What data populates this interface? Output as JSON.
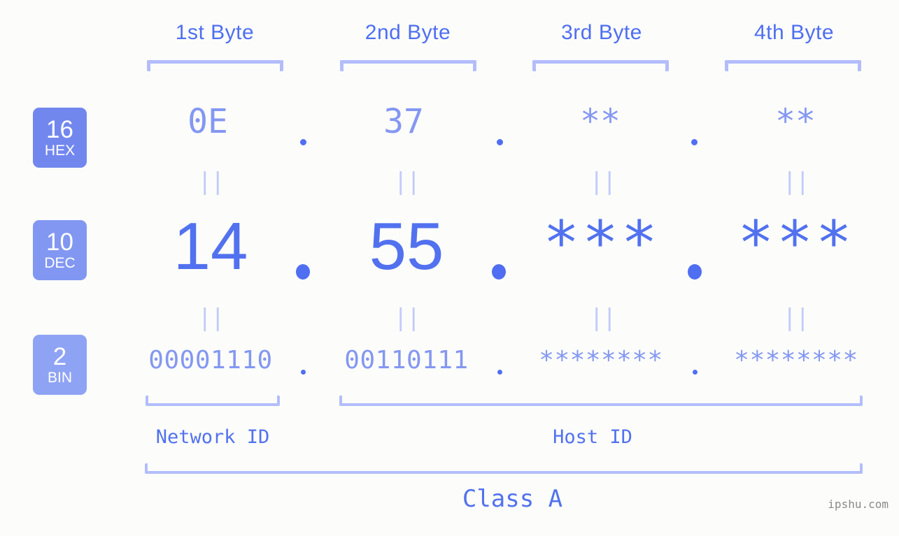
{
  "headers": {
    "bytes": [
      "1st Byte",
      "2nd Byte",
      "3rd Byte",
      "4th Byte"
    ]
  },
  "bases": [
    {
      "number": "16",
      "name": "HEX",
      "color": "#7287ee"
    },
    {
      "number": "10",
      "name": "DEC",
      "color": "#8197f1"
    },
    {
      "number": "2",
      "name": "BIN",
      "color": "#8fa3f4"
    }
  ],
  "rows": {
    "hex": {
      "values": [
        "0E",
        "37",
        "**",
        "**"
      ]
    },
    "dec": {
      "values": [
        "14",
        "55",
        "***",
        "***"
      ]
    },
    "bin": {
      "values": [
        "00001110",
        "00110111",
        "********",
        "********"
      ]
    }
  },
  "separator": ".",
  "equality_marker": "||",
  "regions": [
    {
      "label": "Network ID"
    },
    {
      "label": "Host ID"
    }
  ],
  "class": {
    "label": "Class A"
  },
  "watermark": "ipshu.com",
  "colors": {
    "background": "#fcfdfa",
    "accent_strong": "#4f6ef2",
    "accent_mid": "#5271ef",
    "accent_light": "#8497f2",
    "bracket": "#b3bdfb",
    "equality": "#c3cbfb",
    "watermark": "#8a8a8a"
  }
}
